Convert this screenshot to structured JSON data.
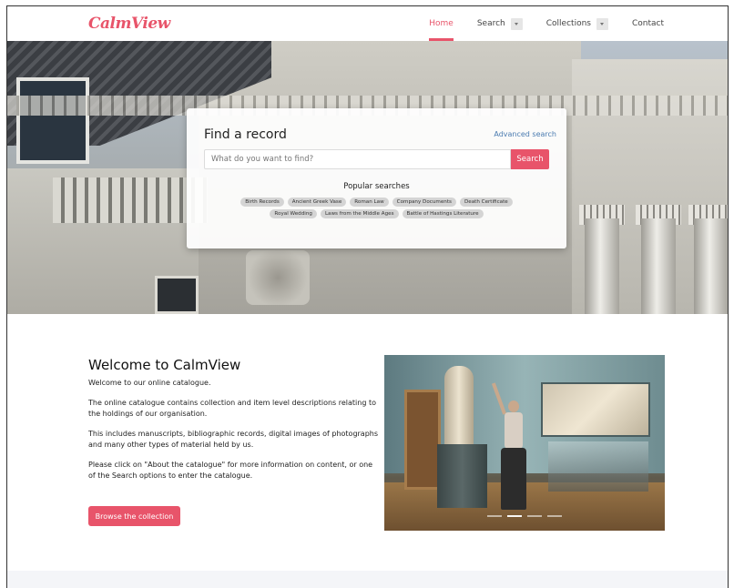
{
  "nav": {
    "logo": "CalmView",
    "items": [
      {
        "label": "Home",
        "active": true,
        "dropdown": false
      },
      {
        "label": "Search",
        "active": false,
        "dropdown": true
      },
      {
        "label": "Collections",
        "active": false,
        "dropdown": true
      },
      {
        "label": "Contact",
        "active": false,
        "dropdown": false
      }
    ]
  },
  "search": {
    "title": "Find a record",
    "advanced_link": "Advanced search",
    "placeholder": "What do you want to find?",
    "button_label": "Search",
    "popular_title": "Popular searches",
    "popular": [
      "Birth Records",
      "Ancient Greek Vase",
      "Roman Law",
      "Company Documents",
      "Death Certificate",
      "Royal Wedding",
      "Laws from the Middle Ages",
      "Battle of Hastings Literature"
    ]
  },
  "welcome": {
    "title": "Welcome to CalmView",
    "paragraphs": [
      "Welcome to our online catalogue.",
      "The online catalogue contains collection and item level descriptions relating to the holdings of our organisation.",
      "This includes manuscripts, bibliographic records, digital images of photographs and many other types of material held by us.",
      "Please click on \"About the catalogue\" for more information on content, or one of the Search options to enter the catalogue."
    ],
    "button_label": "Browse the collection"
  },
  "carousel": {
    "slides": 4,
    "active_index": 1
  },
  "colors": {
    "accent": "#e8546a",
    "link": "#4a7bb0",
    "chip": "#d4d4d4"
  }
}
